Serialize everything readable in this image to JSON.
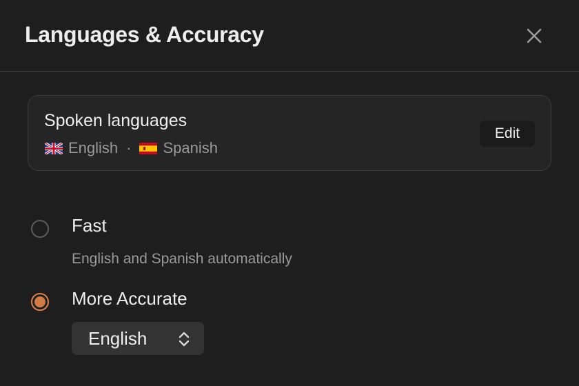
{
  "dialog": {
    "title": "Languages & Accuracy",
    "close_icon": "close-icon"
  },
  "spoken_languages": {
    "title": "Spoken languages",
    "languages": [
      {
        "flag": "uk-flag-icon",
        "name": "English"
      },
      {
        "flag": "spain-flag-icon",
        "name": "Spanish"
      }
    ],
    "separator": "·",
    "edit_label": "Edit"
  },
  "options": {
    "fast": {
      "label": "Fast",
      "description": "English and Spanish automatically",
      "selected": false
    },
    "accurate": {
      "label": "More Accurate",
      "selected": true,
      "select_value": "English",
      "select_icon": "chevron-up-down-icon"
    }
  },
  "colors": {
    "background": "#1e1e1e",
    "accent": "#d07c46",
    "text_primary": "#eeeeee",
    "text_secondary": "#9a9a9a"
  }
}
